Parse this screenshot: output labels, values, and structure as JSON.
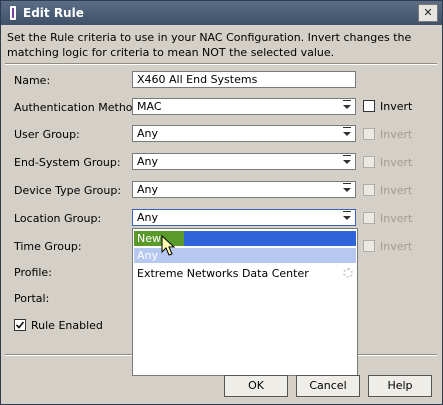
{
  "window": {
    "title": "Edit Rule",
    "close_glyph": "✕"
  },
  "description": "Set the Rule criteria to use in your NAC Configuration. Invert changes the matching logic for criteria to mean NOT the selected value.",
  "form": {
    "name": {
      "label": "Name:",
      "value": "X460 All End Systems"
    },
    "auth": {
      "label": "Authentication Method:",
      "value": "MAC",
      "invert_label": "Invert",
      "invert_enabled": true
    },
    "user_group": {
      "label": "User Group:",
      "value": "Any",
      "invert_label": "Invert"
    },
    "end_system_group": {
      "label": "End-System Group:",
      "value": "Any",
      "invert_label": "Invert"
    },
    "device_type_group": {
      "label": "Device Type Group:",
      "value": "Any",
      "invert_label": "Invert"
    },
    "location_group": {
      "label": "Location Group:",
      "value": "Any",
      "invert_label": "Invert"
    },
    "time_group": {
      "label": "Time Group:",
      "invert_label": "Invert"
    },
    "profile": {
      "label": "Profile:"
    },
    "portal": {
      "label": "Portal:"
    },
    "rule_enabled": {
      "label": "Rule Enabled",
      "checked": true
    }
  },
  "dropdown": {
    "options": [
      "New",
      "Any",
      "Extreme Networks Data Center"
    ],
    "highlighted": "New",
    "selected": "Any"
  },
  "buttons": {
    "ok": "OK",
    "cancel": "Cancel",
    "help": "Help"
  },
  "colors": {
    "titlebar": "#4a5c74",
    "highlight": "#2f63d8",
    "selected": "#b6c8f0"
  }
}
